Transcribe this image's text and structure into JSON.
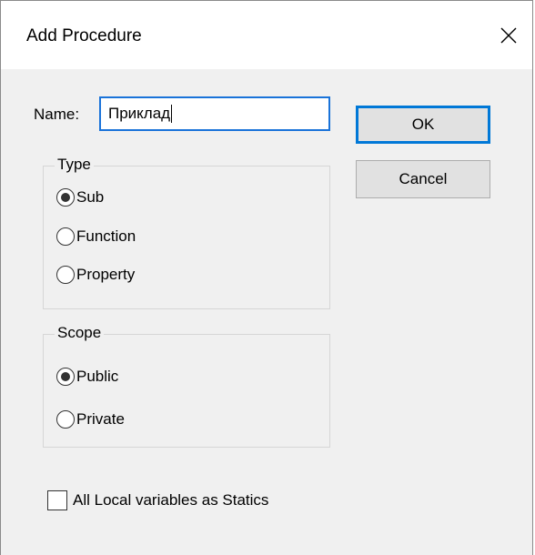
{
  "window": {
    "title": "Add Procedure",
    "close_glyph": "✕"
  },
  "name": {
    "label": "Name:",
    "value": "Приклад"
  },
  "buttons": {
    "ok_label": "OK",
    "cancel_label": "Cancel"
  },
  "type_group": {
    "label": "Type",
    "options": [
      {
        "label": "Sub",
        "selected": true
      },
      {
        "label": "Function",
        "selected": false
      },
      {
        "label": "Property",
        "selected": false
      }
    ]
  },
  "scope_group": {
    "label": "Scope",
    "options": [
      {
        "label": "Public",
        "selected": true
      },
      {
        "label": "Private",
        "selected": false
      }
    ]
  },
  "statics_checkbox": {
    "label": "All Local variables as Statics",
    "checked": false
  },
  "colors": {
    "focus_border": "#0078d7",
    "dialog_bg": "#f0f0f0"
  }
}
